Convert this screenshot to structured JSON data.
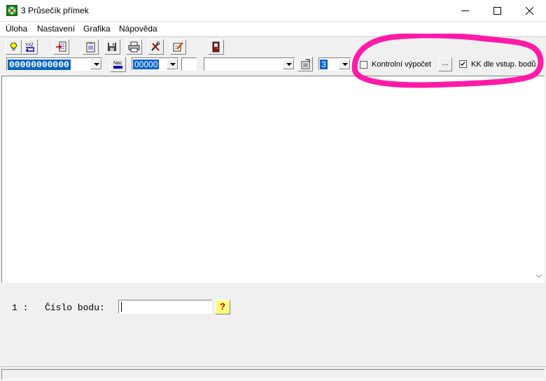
{
  "window": {
    "title": "3  Průsečík přímek",
    "minimize_icon": "minimize-icon",
    "maximize_icon": "maximize-icon",
    "close_icon": "close-icon"
  },
  "menu": {
    "items": [
      "Úloha",
      "Nastavení",
      "Grafika",
      "Nápověda"
    ]
  },
  "toolbar": {
    "buttons": [
      "lightbulb-icon",
      "xyz-sort-icon",
      "import-icon",
      "clipboard-icon",
      "save-icon",
      "print-icon",
      "tools-icon",
      "edit-icon",
      "exit-door-icon"
    ]
  },
  "options_bar": {
    "point_number_mask": "00000000000",
    "nac_button_label": "Nac",
    "short_mask": "00000",
    "precision_value": "3",
    "kontrolni_label": "Kontrolní výpočet",
    "kontrolni_checked": false,
    "ellipsis_label": "...",
    "kk_label": "KK dle vstup. bodů",
    "kk_checked": true
  },
  "prompt": {
    "number": "1 :",
    "label": "Číslo bodu:",
    "value": "",
    "help_label": "?"
  },
  "colors": {
    "selection_blue": "#0a64c8",
    "annotation_magenta": "#ff1aa8",
    "help_yellow": "#ffff80"
  }
}
